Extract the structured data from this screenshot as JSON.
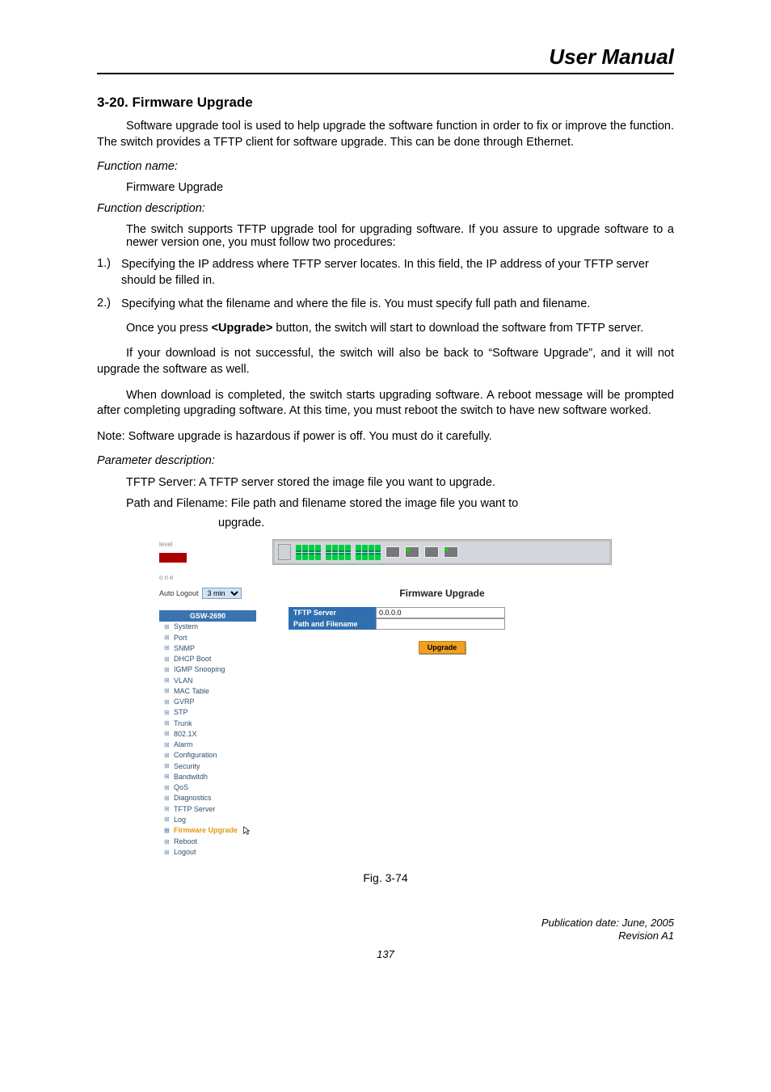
{
  "header": {
    "title": "User Manual"
  },
  "section": {
    "heading": "3-20. Firmware Upgrade",
    "para1": "Software upgrade tool is used to help upgrade the software function in order to fix or improve the function. The switch provides a TFTP client for software upgrade. This can be done through Ethernet.",
    "fn_name_label": "Function name:",
    "fn_name_value": "Firmware Upgrade",
    "fn_desc_label": "Function description:",
    "fn_desc_para": "The switch supports TFTP upgrade tool for upgrading software. If you assure to upgrade software to a newer version one, you must follow two procedures:",
    "step1_num": "1.)",
    "step1": "Specifying the IP address where TFTP server locates. In this field, the IP address of your TFTP server should be filled in.",
    "step2_num": "2.)",
    "step2": "Specifying what the filename and where the file is. You must specify full path and filename.",
    "para_once_pre": "Once you press ",
    "upgrade_bold": "<Upgrade>",
    "para_once_post": " button, the switch will start to download the software from TFTP server.",
    "para_fail": "If your download is not successful, the switch will also be back to “Software Upgrade”, and it will not upgrade the software as well.",
    "para_done": "When download is completed, the switch starts upgrading software. A reboot message will be prompted after completing upgrading software. At this time, you must reboot the switch to have new software worked.",
    "note": "Note: Software upgrade is hazardous if power is off. You must do it carefully.",
    "param_label": "Parameter description:",
    "param1_label": "TFTP Server:",
    "param1_text": "  A TFTP server stored the image file you want to upgrade.",
    "param2_label": "Path and Filename:",
    "param2_text": "  File path and filename stored the image file you want to",
    "param2_cont": "upgrade."
  },
  "screenshot": {
    "logo_top": "level",
    "logo_bot": "one",
    "auto_logout_label": "Auto Logout",
    "auto_logout_value": "3 min",
    "menu_head": "GSW-2690",
    "menu_items": [
      "System",
      "Port",
      "SNMP",
      "DHCP Boot",
      "IGMP Snooping",
      "VLAN",
      "MAC Table",
      "GVRP",
      "STP",
      "Trunk",
      "802.1X",
      "Alarm",
      "Configuration",
      "Security",
      "Bandwitdh",
      "QoS",
      "Diagnostics",
      "TFTP Server",
      "Log",
      "Firmware Upgrade",
      "Reboot",
      "Logout"
    ],
    "selected_index": 19,
    "content_title": "Firmware Upgrade",
    "row1_label": "TFTP Server",
    "row1_value": "0.0.0.0",
    "row2_label": "Path and Filename",
    "row2_value": "",
    "upgrade_button": "Upgrade"
  },
  "figure_caption": "Fig. 3-74",
  "footer": {
    "pub_date": "Publication date: June, 2005",
    "revision": "Revision A1",
    "page_number": "137"
  }
}
